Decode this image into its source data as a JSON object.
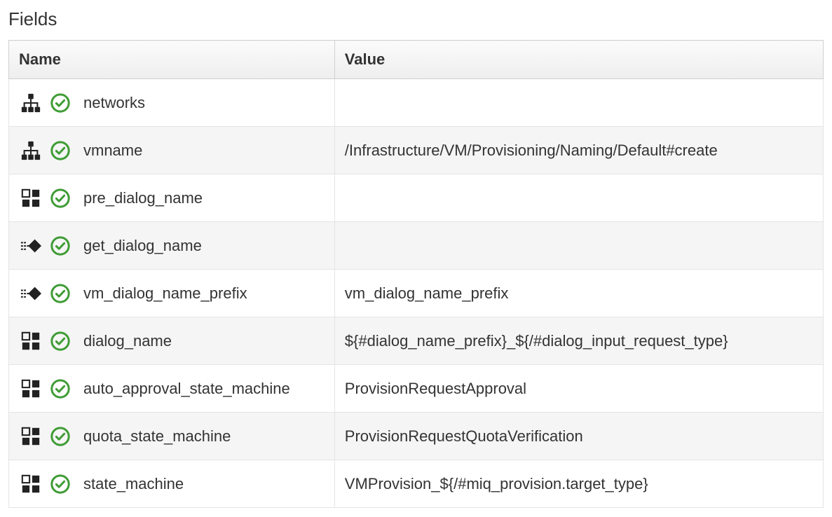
{
  "section_title": "Fields",
  "table": {
    "headers": {
      "name": "Name",
      "value": "Value"
    },
    "rows": [
      {
        "type": "relationship",
        "status": "ok",
        "name": "networks",
        "value": ""
      },
      {
        "type": "relationship",
        "status": "ok",
        "name": "vmname",
        "value": "/Infrastructure/VM/Provisioning/Naming/Default#create"
      },
      {
        "type": "attribute",
        "status": "ok",
        "name": "pre_dialog_name",
        "value": ""
      },
      {
        "type": "method",
        "status": "ok",
        "name": "get_dialog_name",
        "value": ""
      },
      {
        "type": "method",
        "status": "ok",
        "name": "vm_dialog_name_prefix",
        "value": "vm_dialog_name_prefix"
      },
      {
        "type": "attribute",
        "status": "ok",
        "name": "dialog_name",
        "value": "${#dialog_name_prefix}_${/#dialog_input_request_type}"
      },
      {
        "type": "attribute",
        "status": "ok",
        "name": "auto_approval_state_machine",
        "value": "ProvisionRequestApproval"
      },
      {
        "type": "attribute",
        "status": "ok",
        "name": "quota_state_machine",
        "value": "ProvisionRequestQuotaVerification"
      },
      {
        "type": "attribute",
        "status": "ok",
        "name": "state_machine",
        "value": "VMProvision_${/#miq_provision.target_type}"
      }
    ]
  }
}
